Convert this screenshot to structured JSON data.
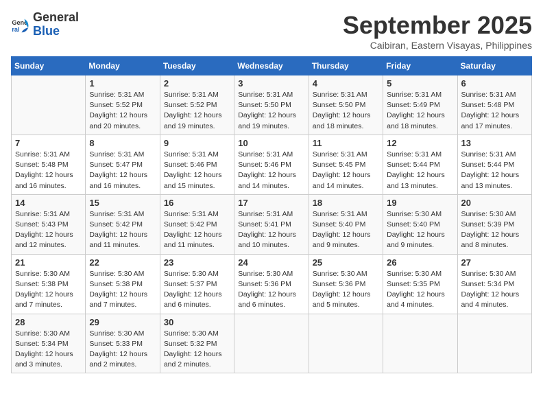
{
  "logo": {
    "line1": "General",
    "line2": "Blue"
  },
  "title": "September 2025",
  "subtitle": "Caibiran, Eastern Visayas, Philippines",
  "days_of_week": [
    "Sunday",
    "Monday",
    "Tuesday",
    "Wednesday",
    "Thursday",
    "Friday",
    "Saturday"
  ],
  "weeks": [
    [
      {
        "day": "",
        "info": ""
      },
      {
        "day": "1",
        "info": "Sunrise: 5:31 AM\nSunset: 5:52 PM\nDaylight: 12 hours\nand 20 minutes."
      },
      {
        "day": "2",
        "info": "Sunrise: 5:31 AM\nSunset: 5:52 PM\nDaylight: 12 hours\nand 19 minutes."
      },
      {
        "day": "3",
        "info": "Sunrise: 5:31 AM\nSunset: 5:50 PM\nDaylight: 12 hours\nand 19 minutes."
      },
      {
        "day": "4",
        "info": "Sunrise: 5:31 AM\nSunset: 5:50 PM\nDaylight: 12 hours\nand 18 minutes."
      },
      {
        "day": "5",
        "info": "Sunrise: 5:31 AM\nSunset: 5:49 PM\nDaylight: 12 hours\nand 18 minutes."
      },
      {
        "day": "6",
        "info": "Sunrise: 5:31 AM\nSunset: 5:48 PM\nDaylight: 12 hours\nand 17 minutes."
      }
    ],
    [
      {
        "day": "7",
        "info": "Sunrise: 5:31 AM\nSunset: 5:48 PM\nDaylight: 12 hours\nand 16 minutes."
      },
      {
        "day": "8",
        "info": "Sunrise: 5:31 AM\nSunset: 5:47 PM\nDaylight: 12 hours\nand 16 minutes."
      },
      {
        "day": "9",
        "info": "Sunrise: 5:31 AM\nSunset: 5:46 PM\nDaylight: 12 hours\nand 15 minutes."
      },
      {
        "day": "10",
        "info": "Sunrise: 5:31 AM\nSunset: 5:46 PM\nDaylight: 12 hours\nand 14 minutes."
      },
      {
        "day": "11",
        "info": "Sunrise: 5:31 AM\nSunset: 5:45 PM\nDaylight: 12 hours\nand 14 minutes."
      },
      {
        "day": "12",
        "info": "Sunrise: 5:31 AM\nSunset: 5:44 PM\nDaylight: 12 hours\nand 13 minutes."
      },
      {
        "day": "13",
        "info": "Sunrise: 5:31 AM\nSunset: 5:44 PM\nDaylight: 12 hours\nand 13 minutes."
      }
    ],
    [
      {
        "day": "14",
        "info": "Sunrise: 5:31 AM\nSunset: 5:43 PM\nDaylight: 12 hours\nand 12 minutes."
      },
      {
        "day": "15",
        "info": "Sunrise: 5:31 AM\nSunset: 5:42 PM\nDaylight: 12 hours\nand 11 minutes."
      },
      {
        "day": "16",
        "info": "Sunrise: 5:31 AM\nSunset: 5:42 PM\nDaylight: 12 hours\nand 11 minutes."
      },
      {
        "day": "17",
        "info": "Sunrise: 5:31 AM\nSunset: 5:41 PM\nDaylight: 12 hours\nand 10 minutes."
      },
      {
        "day": "18",
        "info": "Sunrise: 5:31 AM\nSunset: 5:40 PM\nDaylight: 12 hours\nand 9 minutes."
      },
      {
        "day": "19",
        "info": "Sunrise: 5:30 AM\nSunset: 5:40 PM\nDaylight: 12 hours\nand 9 minutes."
      },
      {
        "day": "20",
        "info": "Sunrise: 5:30 AM\nSunset: 5:39 PM\nDaylight: 12 hours\nand 8 minutes."
      }
    ],
    [
      {
        "day": "21",
        "info": "Sunrise: 5:30 AM\nSunset: 5:38 PM\nDaylight: 12 hours\nand 7 minutes."
      },
      {
        "day": "22",
        "info": "Sunrise: 5:30 AM\nSunset: 5:38 PM\nDaylight: 12 hours\nand 7 minutes."
      },
      {
        "day": "23",
        "info": "Sunrise: 5:30 AM\nSunset: 5:37 PM\nDaylight: 12 hours\nand 6 minutes."
      },
      {
        "day": "24",
        "info": "Sunrise: 5:30 AM\nSunset: 5:36 PM\nDaylight: 12 hours\nand 6 minutes."
      },
      {
        "day": "25",
        "info": "Sunrise: 5:30 AM\nSunset: 5:36 PM\nDaylight: 12 hours\nand 5 minutes."
      },
      {
        "day": "26",
        "info": "Sunrise: 5:30 AM\nSunset: 5:35 PM\nDaylight: 12 hours\nand 4 minutes."
      },
      {
        "day": "27",
        "info": "Sunrise: 5:30 AM\nSunset: 5:34 PM\nDaylight: 12 hours\nand 4 minutes."
      }
    ],
    [
      {
        "day": "28",
        "info": "Sunrise: 5:30 AM\nSunset: 5:34 PM\nDaylight: 12 hours\nand 3 minutes."
      },
      {
        "day": "29",
        "info": "Sunrise: 5:30 AM\nSunset: 5:33 PM\nDaylight: 12 hours\nand 2 minutes."
      },
      {
        "day": "30",
        "info": "Sunrise: 5:30 AM\nSunset: 5:32 PM\nDaylight: 12 hours\nand 2 minutes."
      },
      {
        "day": "",
        "info": ""
      },
      {
        "day": "",
        "info": ""
      },
      {
        "day": "",
        "info": ""
      },
      {
        "day": "",
        "info": ""
      }
    ]
  ]
}
